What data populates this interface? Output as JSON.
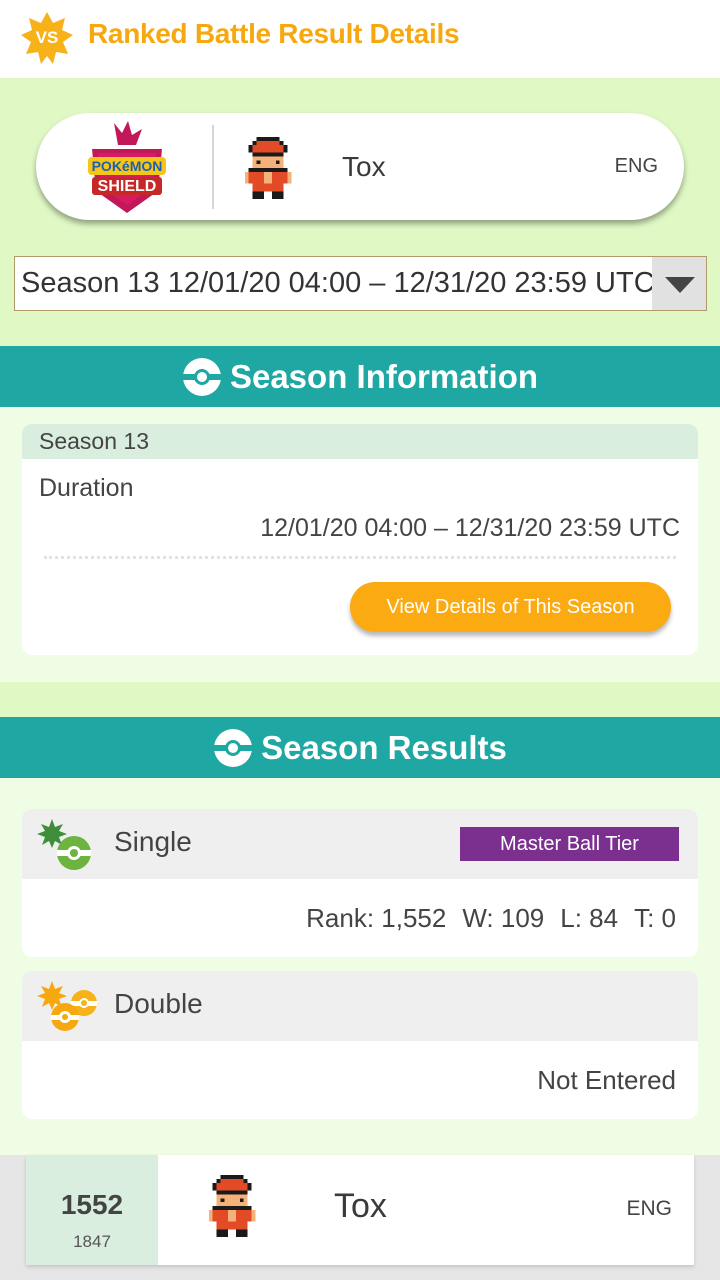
{
  "header": {
    "badge_text": "VS",
    "title": "Ranked Battle Result Details",
    "accent_color": "#f6a80e"
  },
  "profile": {
    "game_logo_icon": "pokemon-shield-logo",
    "trainer_sprite_icon": "trainer-sprite",
    "trainer_name": "Tox",
    "language": "ENG"
  },
  "season_select": {
    "selected": "Season 13 12/01/20 04:00 – 12/31/20 23:59 UTC"
  },
  "season_information": {
    "section_title": "Season Information",
    "season_label": "Season 13",
    "duration_label": "Duration",
    "duration_value": "12/01/20 04:00 – 12/31/20 23:59 UTC",
    "view_button": "View Details of This Season"
  },
  "season_results": {
    "section_title": "Season Results",
    "single": {
      "label": "Single",
      "tier": "Master Ball Tier",
      "rank": "Rank: 1,552",
      "wins": "W: 109",
      "losses": "L: 84",
      "ties": "T: 0"
    },
    "double": {
      "label": "Double",
      "status": "Not Entered"
    }
  },
  "bottom_bar": {
    "rank": "1552",
    "rating": "1847",
    "trainer_name": "Tox",
    "language": "ENG"
  },
  "colors": {
    "teal_section": "#1ea7a3",
    "light_green": "#dff8c4",
    "orange_button": "#fbab11",
    "tier_purple": "#7b2f8f"
  }
}
